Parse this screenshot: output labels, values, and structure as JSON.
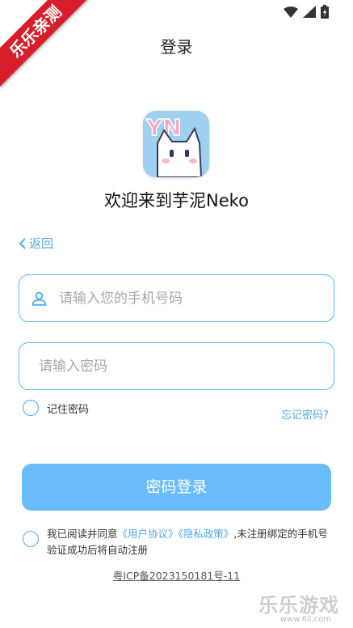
{
  "header": {
    "title": "登录"
  },
  "ribbon": {
    "text": "乐乐亲测"
  },
  "app": {
    "welcome": "欢迎来到芋泥Neko",
    "logo_text": "YN"
  },
  "nav": {
    "back_label": "返回"
  },
  "form": {
    "phone_placeholder": "请输入您的手机号码",
    "phone_value": "",
    "password_placeholder": "请输入密码",
    "password_value": "",
    "remember_label": "记住密码",
    "forgot_label": "忘记密码?",
    "login_button": "密码登录"
  },
  "agreement": {
    "prefix": "我已阅读并同意",
    "user_agreement": "《用户协议》",
    "privacy_policy": "《隐私政策》",
    "suffix": ",未注册绑定的手机号验证成功后将自动注册"
  },
  "footer": {
    "icp": "粤ICP备2023150181号-11"
  },
  "watermark": {
    "text": "乐乐游戏",
    "sub": "www.6ll.com"
  },
  "colors": {
    "accent": "#4fa8ea",
    "button": "#6bbcfb",
    "ribbon": "#d81e2a"
  },
  "status_icons": [
    "wifi-icon",
    "signal-icon",
    "battery-icon"
  ]
}
